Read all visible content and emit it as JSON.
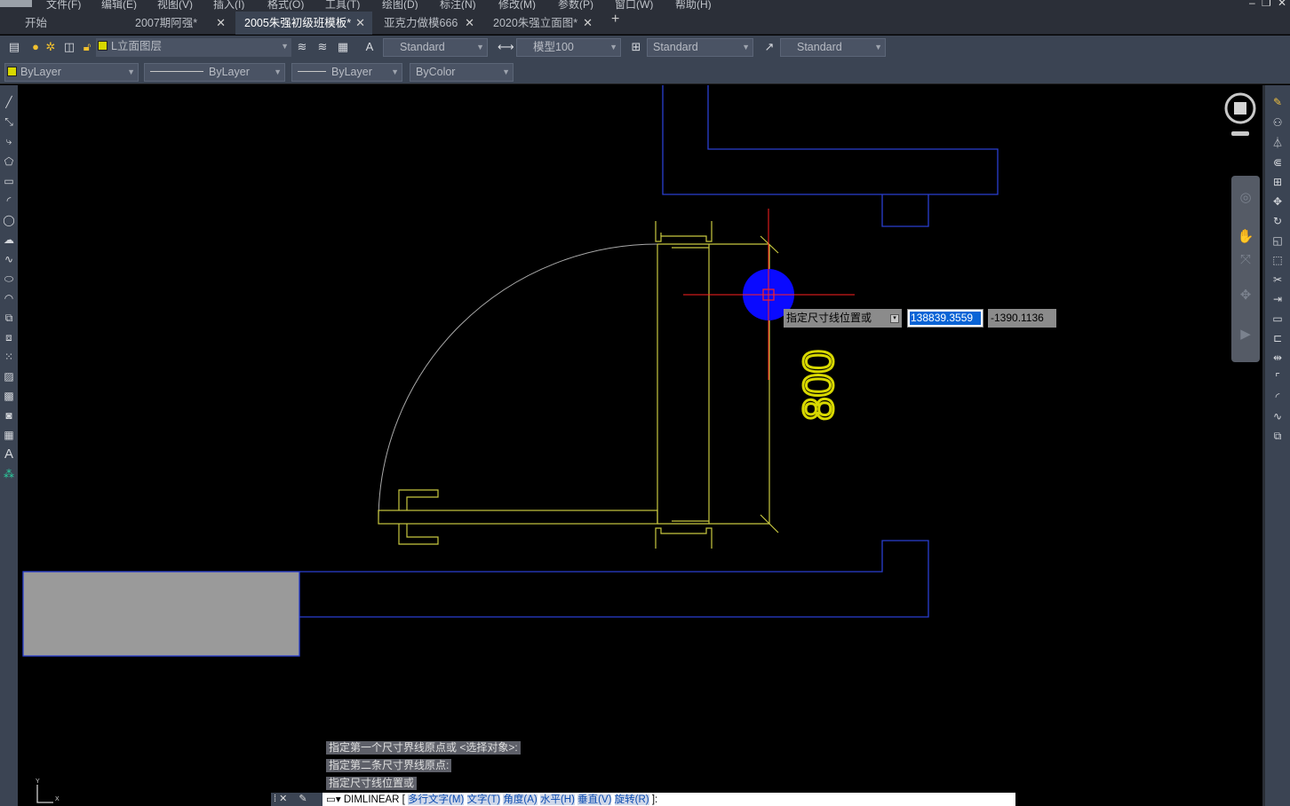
{
  "menu": {
    "items": [
      "文件(F)",
      "编辑(E)",
      "视图(V)",
      "插入(I)",
      "格式(O)",
      "工具(T)",
      "绘图(D)",
      "标注(N)",
      "修改(M)",
      "参数(P)",
      "窗口(W)",
      "帮助(H)"
    ]
  },
  "tabs": [
    {
      "label": "开始",
      "active": false,
      "closable": false
    },
    {
      "label": "2007期阿强*",
      "active": false,
      "closable": true
    },
    {
      "label": "2005朱强初级班模板*",
      "active": true,
      "closable": true
    },
    {
      "label": "亚克力做模666",
      "active": false,
      "closable": true
    },
    {
      "label": "2020朱强立面图*",
      "active": false,
      "closable": true
    }
  ],
  "tab_close_glyph": "✕",
  "tab_add_glyph": "+",
  "toolbar1": {
    "layer": "L立面图层",
    "layer_color": "#d8d800",
    "text_style": "Standard",
    "dim_style": "模型100",
    "table_style": "Standard",
    "multileader_style": "Standard"
  },
  "toolbar2": {
    "color": "ByLayer",
    "linetype": "ByLayer",
    "lineweight": "ByLayer",
    "plotstyle": "ByColor"
  },
  "drawing": {
    "dimension_text": "800",
    "dimension_color": "#d8d800",
    "wall_color": "#2a3fd0",
    "door_color": "#c8c840",
    "crosshair_color": "#ff2020",
    "cursor_color": "#0a0aff"
  },
  "dynamic_input": {
    "prompt": "指定尺寸线位置或",
    "x_value": "138839.3559",
    "y_value": "-1390.1136"
  },
  "command": {
    "history": [
      "指定第一个尺寸界线原点或 <选择对象>:",
      "指定第二条尺寸界线原点:",
      "指定尺寸线位置或"
    ],
    "current_prefix": "DIMLINEAR [",
    "options": [
      "多行文字(M)",
      "文字(T)",
      "角度(A)",
      "水平(H)",
      "垂直(V)",
      "旋转(R)"
    ],
    "current_suffix": "]:"
  },
  "ucs": {
    "x_label": "X",
    "y_label": "Y"
  },
  "colors": {
    "panel": "#3b4453",
    "tabbar": "#2b2f38",
    "canvas": "#000000",
    "selection": "#0a64d6"
  }
}
